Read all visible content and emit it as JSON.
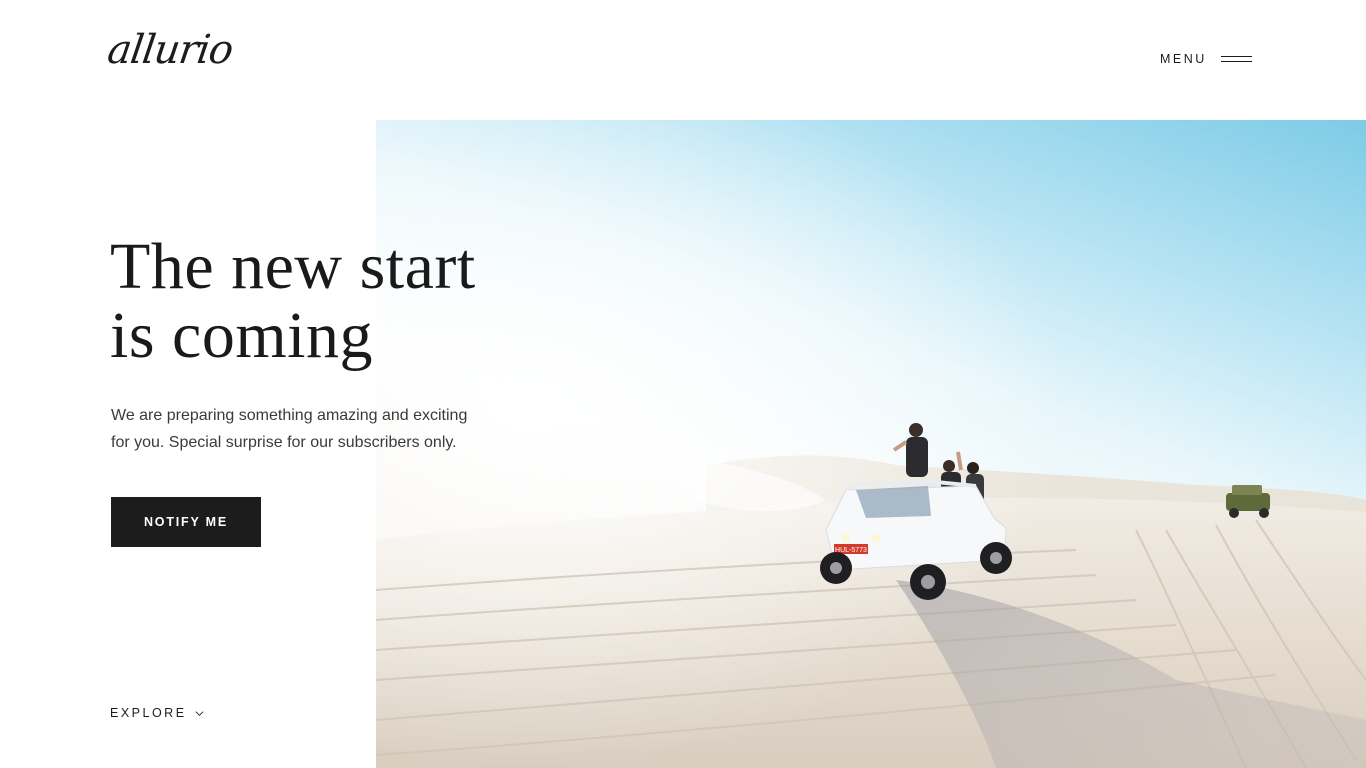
{
  "header": {
    "logo_text": "allurio",
    "menu_label": "MENU",
    "menu_icon": "hamburger-icon"
  },
  "hero": {
    "headline_line1": "The new start",
    "headline_line2": "is coming",
    "description_line1": "We are preparing something amazing and exciting",
    "description_line2": "for you. Special surprise for our subscribers only.",
    "notify_button_label": "NOTIFY ME",
    "explore_label": "EXPLORE",
    "explore_icon": "chevron-down-icon",
    "image_alt": "Beach buggy driving on sandy dunes",
    "image_plate_text": "HUL-5773"
  },
  "colors": {
    "text_dark": "#1c1c1c",
    "button_bg": "#1c1c1c",
    "button_text": "#ffffff",
    "sky_blue": "#7dcbe6"
  }
}
